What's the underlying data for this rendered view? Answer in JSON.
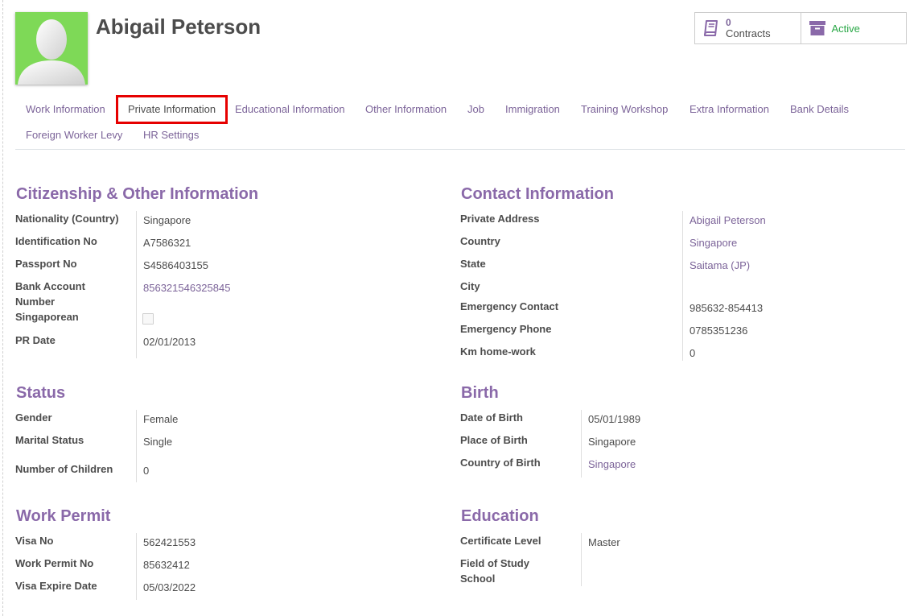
{
  "employee": {
    "name": "Abigail Peterson"
  },
  "stat_buttons": {
    "contracts": {
      "value": "0",
      "label": "Contracts",
      "icon": "book-icon"
    },
    "active": {
      "label": "Active",
      "icon": "archive-icon"
    }
  },
  "tabs": [
    {
      "label": "Work Information",
      "active": false
    },
    {
      "label": "Private Information",
      "active": true
    },
    {
      "label": "Educational Information",
      "active": false
    },
    {
      "label": "Other Information",
      "active": false
    },
    {
      "label": "Job",
      "active": false
    },
    {
      "label": "Immigration",
      "active": false
    },
    {
      "label": "Training Workshop",
      "active": false
    },
    {
      "label": "Extra Information",
      "active": false
    },
    {
      "label": "Bank Details",
      "active": false
    },
    {
      "label": "Foreign Worker Levy",
      "active": false
    },
    {
      "label": "HR Settings",
      "active": false
    }
  ],
  "citizenship": {
    "title": "Citizenship & Other Information",
    "nationality": {
      "label": "Nationality (Country)",
      "value": "Singapore"
    },
    "identification": {
      "label": "Identification No",
      "value": "A7586321"
    },
    "passport": {
      "label": "Passport No",
      "value": "S4586403155"
    },
    "bank_account": {
      "label_line1": "Bank Account",
      "label_line2": "Number",
      "value": "856321546325845"
    },
    "singaporean": {
      "label": "Singaporean",
      "checked": false
    },
    "pr_date": {
      "label": "PR Date",
      "value": "02/01/2013"
    }
  },
  "contact": {
    "title": "Contact Information",
    "private_address": {
      "label": "Private Address",
      "value": "Abigail Peterson"
    },
    "country": {
      "label": "Country",
      "value": "Singapore"
    },
    "state": {
      "label": "State",
      "value": "Saitama (JP)"
    },
    "city": {
      "label": "City",
      "value": ""
    },
    "emergency_contact": {
      "label": "Emergency Contact",
      "value": "985632-854413"
    },
    "emergency_phone": {
      "label": "Emergency Phone",
      "value": "0785351236"
    },
    "km_home_work": {
      "label": "Km home-work",
      "value": "0"
    }
  },
  "status": {
    "title": "Status",
    "gender": {
      "label": "Gender",
      "value": "Female"
    },
    "marital": {
      "label": "Marital Status",
      "value": "Single"
    },
    "children": {
      "label": "Number of Children",
      "value": "0"
    }
  },
  "birth": {
    "title": "Birth",
    "date": {
      "label": "Date of Birth",
      "value": "05/01/1989"
    },
    "place": {
      "label": "Place of Birth",
      "value": "Singapore"
    },
    "country": {
      "label": "Country of Birth",
      "value": "Singapore"
    }
  },
  "work_permit": {
    "title": "Work Permit",
    "visa_no": {
      "label": "Visa No",
      "value": "562421553"
    },
    "permit_no": {
      "label": "Work Permit No",
      "value": "85632412"
    },
    "visa_expire": {
      "label": "Visa Expire Date",
      "value": "05/03/2022"
    }
  },
  "education": {
    "title": "Education",
    "certificate": {
      "label": "Certificate Level",
      "value": "Master"
    },
    "field_of_study": {
      "label": "Field of Study",
      "value": ""
    },
    "school": {
      "label": "School",
      "value": ""
    }
  },
  "colors": {
    "accent": "#8a69a9",
    "link": "#7c6499",
    "active_green": "#28a745",
    "avatar_bg": "#7ed957",
    "tab_highlight": "#e60000"
  }
}
